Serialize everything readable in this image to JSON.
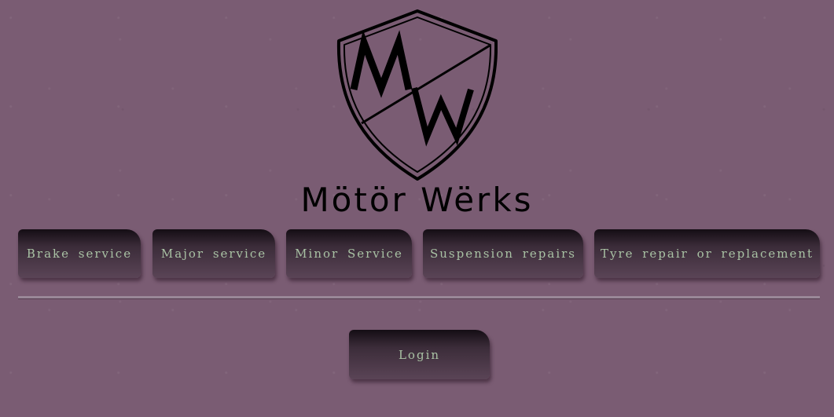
{
  "brand": {
    "logo_letters": "MW",
    "name": "Mötör Wërks"
  },
  "nav": {
    "items": [
      {
        "label": "Brake service"
      },
      {
        "label": "Major service"
      },
      {
        "label": "Minor Service"
      },
      {
        "label": "Suspension repairs"
      },
      {
        "label": "Tyre repair or replacement"
      }
    ]
  },
  "login": {
    "label": "Login"
  },
  "colors": {
    "background": "#7a5c73",
    "button_text": "#a9c2a4",
    "button_dark": "#140d14",
    "logo": "#000000"
  }
}
